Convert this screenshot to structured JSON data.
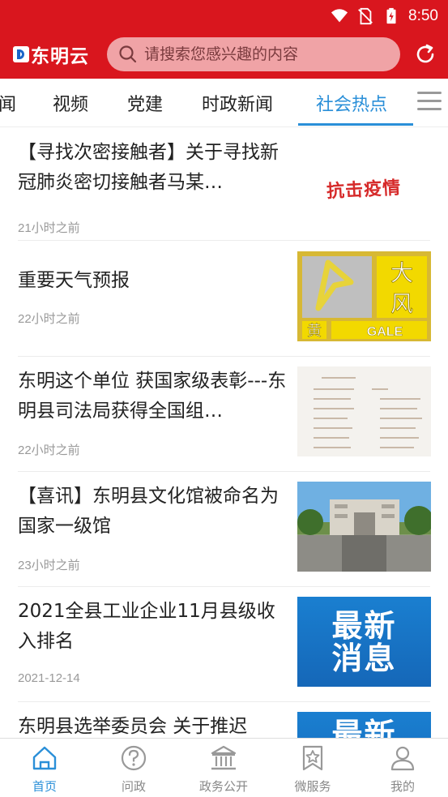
{
  "status": {
    "time": "8:50",
    "icons": [
      "wifi-icon",
      "no-sim-icon",
      "battery-charging-icon"
    ]
  },
  "header": {
    "logo_text": "东明云",
    "search_placeholder": "请搜索您感兴趣的内容",
    "refresh_icon": "refresh-icon",
    "brand_color": "#d9161e"
  },
  "tabs": [
    {
      "label": "闻"
    },
    {
      "label": "视频"
    },
    {
      "label": "党建"
    },
    {
      "label": "时政新闻"
    },
    {
      "label": "社会热点",
      "active": true
    }
  ],
  "accent_color": "#2a8fd8",
  "news": [
    {
      "title": "【寻找次密接触者】关于寻找新冠肺炎密切接触者马某…",
      "time": "21小时之前",
      "thumb_text": "抗击疫情"
    },
    {
      "title": "重要天气预报",
      "time": "22小时之前",
      "thumb_text_1": "大",
      "thumb_text_2": "风",
      "thumb_text_3": "黄",
      "thumb_text_4": "GALE"
    },
    {
      "title": "东明这个单位 获国家级表彰---东明县司法局获得全国组…",
      "time": "22小时之前"
    },
    {
      "title": "【喜讯】东明县文化馆被命名为国家一级馆",
      "time": "23小时之前"
    },
    {
      "title": "2021全县工业企业11月县级收入排名",
      "time": "2021-12-14",
      "thumb_line1": "最新",
      "thumb_line2": "消息"
    },
    {
      "title": "东明县选举委员会 关于推迟",
      "thumb_line1": "最新"
    }
  ],
  "bottom_nav": [
    {
      "label": "首页",
      "icon": "home-icon",
      "active": true
    },
    {
      "label": "问政",
      "icon": "question-icon"
    },
    {
      "label": "政务公开",
      "icon": "government-building-icon"
    },
    {
      "label": "微服务",
      "icon": "star-bookmark-icon"
    },
    {
      "label": "我的",
      "icon": "user-icon"
    }
  ]
}
